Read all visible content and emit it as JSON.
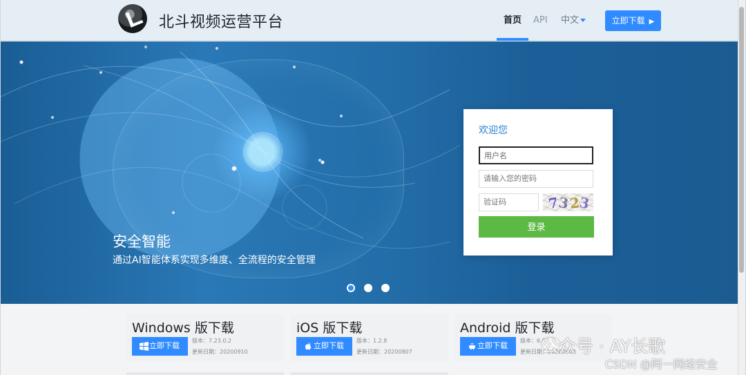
{
  "header": {
    "brand": "北斗视频运营平台",
    "nav": {
      "home": "首页",
      "api": "API",
      "language": "中文"
    },
    "download_button": "立即下载"
  },
  "hero": {
    "title": "安全智能",
    "subtitle": "通过AI智能体系实现多维度、全流程的安全管理",
    "carousel": {
      "dots": 3,
      "active_index": 0
    }
  },
  "login": {
    "title": "欢迎您",
    "username_placeholder": "用户名",
    "password_placeholder": "请输入您的密码",
    "captcha_placeholder": "验证码",
    "captcha_text": "7323",
    "submit": "登录"
  },
  "downloads": [
    {
      "title": "Windows 版下载",
      "button": "立即下载",
      "version": "版本：7.23.0.2",
      "date": "更新日期：20200910",
      "icon": "windows-icon"
    },
    {
      "title": "iOS 版下载",
      "button": "立即下载",
      "version": "版本：1.2.8",
      "date": "更新日期：20200807",
      "icon": "apple-icon"
    },
    {
      "title": "Android 版下载",
      "button": "立即下载",
      "version": "版本：6.0.5.9",
      "date": "更新日期：20200908",
      "icon": "android-icon"
    }
  ],
  "watermark": {
    "main": "公众号 · AY长歌",
    "sub": "CSDN @阿一网络安全"
  },
  "colors": {
    "accent": "#2f8bff",
    "login_button": "#5bb944",
    "hero_blue": "#236ea9"
  }
}
